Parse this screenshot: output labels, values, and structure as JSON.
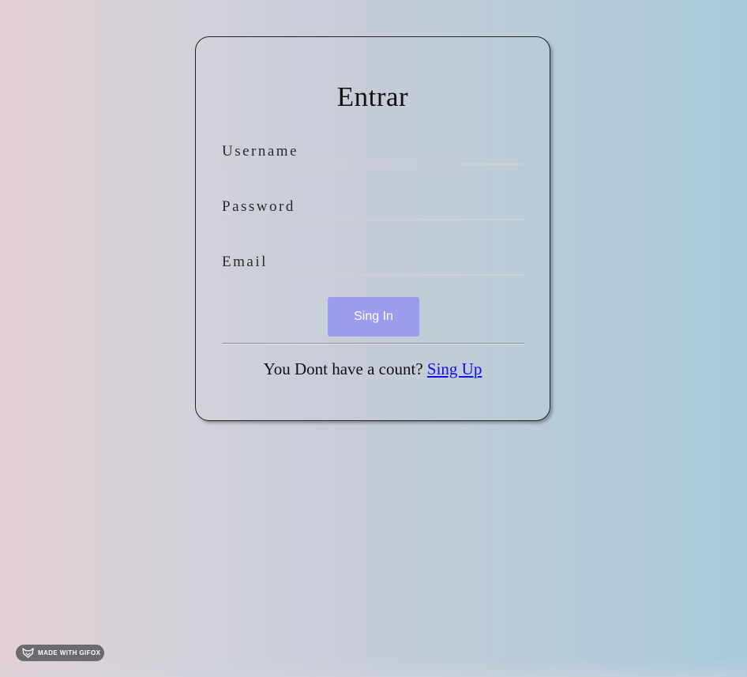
{
  "login": {
    "title": "Entrar",
    "username_placeholder": "Username",
    "password_placeholder": "Password",
    "email_placeholder": "Email",
    "signin_label": "Sing In",
    "signup_prompt": "You Dont have a count? ",
    "signup_link": "Sing Up"
  },
  "badge": {
    "text": "MADE WITH GIFOX",
    "icon": "fox-icon"
  },
  "colors": {
    "button": "#9b9ced",
    "link": "#1010e0",
    "gradient_left": "#e3d0d4",
    "gradient_right": "#a9c9dc"
  }
}
